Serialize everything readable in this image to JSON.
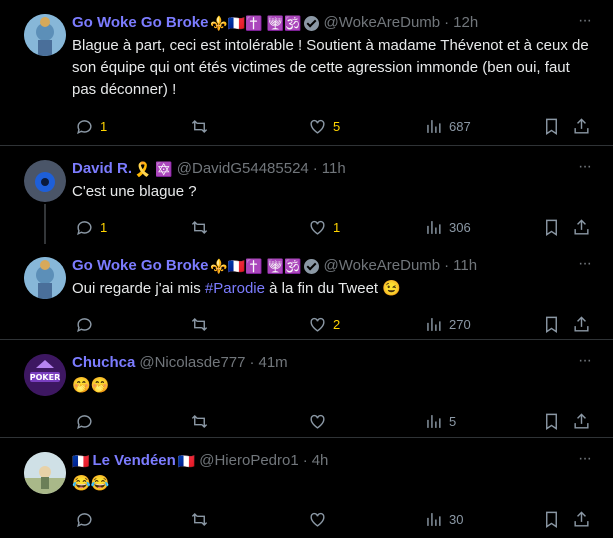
{
  "tweets": [
    {
      "name": "Go Woke Go Broke",
      "name_emojis": "⚜️🇫🇷✝️ 🕎🕉️",
      "handle": "@WokeAreDumb",
      "time": "12h",
      "text": "Blague à part, ceci est intolérable ! Soutient à madame Thévenot et à ceux de son équipe qui ont étés victimes de cette agression immonde (ben oui, faut pas déconner) !",
      "replies": "1",
      "retweets": "",
      "likes": "5",
      "views": "687"
    },
    {
      "name": "David R.",
      "name_emojis": "🎗️ 🔯",
      "handle": "@DavidG54485524",
      "time": "11h",
      "text": "C'est une blague ?",
      "replies": "1",
      "retweets": "",
      "likes": "1",
      "views": "306"
    },
    {
      "name": "Go Woke Go Broke",
      "name_emojis": "⚜️🇫🇷✝️ 🕎🕉️",
      "handle": "@WokeAreDumb",
      "time": "11h",
      "text_before": "Oui regarde j'ai mis ",
      "hashtag": "#Parodie",
      "text_after": " à la fin du Tweet 😉",
      "replies": "",
      "retweets": "",
      "likes": "2",
      "views": "270"
    },
    {
      "name": "Chuchca",
      "name_emojis": "",
      "handle": "@Nicolasde777",
      "time": "41m",
      "text": "🤭🤭",
      "replies": "",
      "retweets": "",
      "likes": "",
      "views": "5"
    },
    {
      "name": "Le Vendéen",
      "name_prefix": "🇫🇷",
      "name_emojis": "🇫🇷",
      "handle": "@HieroPedro1",
      "time": "4h",
      "text": "😂😂",
      "replies": "",
      "retweets": "",
      "likes": "",
      "views": "30"
    }
  ],
  "ui": {
    "dot": "·",
    "more": "···"
  }
}
